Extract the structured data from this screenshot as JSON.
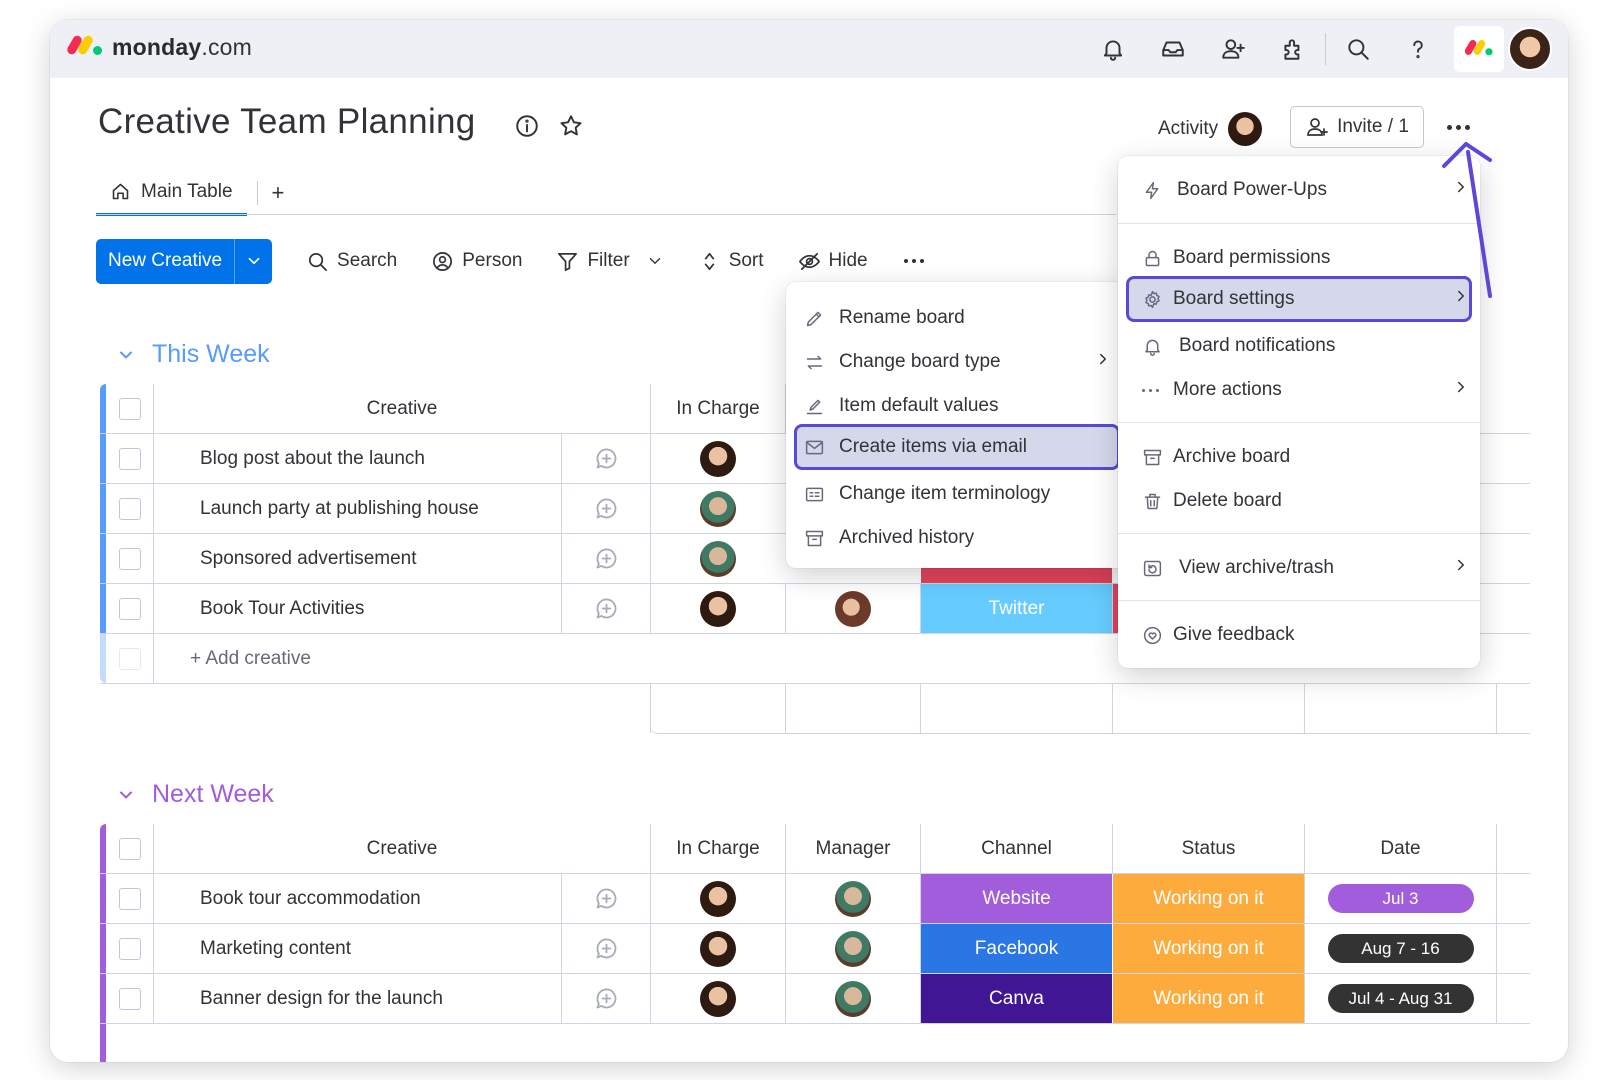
{
  "app": {
    "logo_bold": "monday",
    "logo_light": ".com",
    "board_title": "Creative Team Planning",
    "activity_label": "Activity",
    "invite_label": "Invite / 1"
  },
  "topbar_icons": [
    "bell-icon",
    "inbox-icon",
    "invite-members-icon",
    "apps-icon",
    "search-icon",
    "help-icon"
  ],
  "tabs": {
    "main": "Main Table",
    "add": "+"
  },
  "toolbar": {
    "new_item": "New Creative",
    "search": "Search",
    "person": "Person",
    "filter": "Filter",
    "sort": "Sort",
    "hide": "Hide"
  },
  "groups": [
    {
      "title": "This Week",
      "color": "#579bfc",
      "headers": {
        "item": "Creative",
        "in_charge": "In Charge"
      },
      "rows": [
        {
          "name": "Blog post about the launch"
        },
        {
          "name": "Launch party at publishing house"
        },
        {
          "name": "Sponsored advertisement"
        },
        {
          "name": "Book Tour Activities",
          "channel": "Twitter",
          "channel_color": "#66ccff"
        }
      ],
      "add_label": "+ Add creative"
    },
    {
      "title": "Next Week",
      "color": "#a25ddc",
      "headers": {
        "item": "Creative",
        "in_charge": "In Charge",
        "manager": "Manager",
        "channel": "Channel",
        "status": "Status",
        "date": "Date"
      },
      "rows": [
        {
          "name": "Book tour accommodation",
          "channel": "Website",
          "channel_color": "#a25ddc",
          "status": "Working on it",
          "status_color": "#fdab3d",
          "date": "Jul 3",
          "date_color": "#a25ddc"
        },
        {
          "name": "Marketing content",
          "channel": "Facebook",
          "channel_color": "#2b76e5",
          "status": "Working on it",
          "status_color": "#fdab3d",
          "date": "Aug 7 - 16",
          "date_color": "#333333"
        },
        {
          "name": "Banner design for the launch",
          "channel": "Canva",
          "channel_color": "#401694",
          "status": "Working on it",
          "status_color": "#fdab3d",
          "date": "Jul 4 - Aug 31",
          "date_color": "#333333"
        }
      ]
    }
  ],
  "board_menu": {
    "power_ups": "Board Power-Ups",
    "permissions": "Board permissions",
    "settings": "Board settings",
    "notifications": "Board notifications",
    "more_actions": "More actions",
    "archive": "Archive board",
    "delete": "Delete board",
    "view_archive": "View archive/trash",
    "feedback": "Give feedback"
  },
  "settings_submenu": {
    "rename": "Rename board",
    "change_type": "Change board type",
    "default_values": "Item default values",
    "create_via_email": "Create items via email",
    "terminology": "Change item terminology",
    "archived_history": "Archived history"
  },
  "colors": {
    "primary": "#0073ea",
    "highlight_border": "#5b48d9",
    "annotation_arrow": "#5b48d9"
  }
}
